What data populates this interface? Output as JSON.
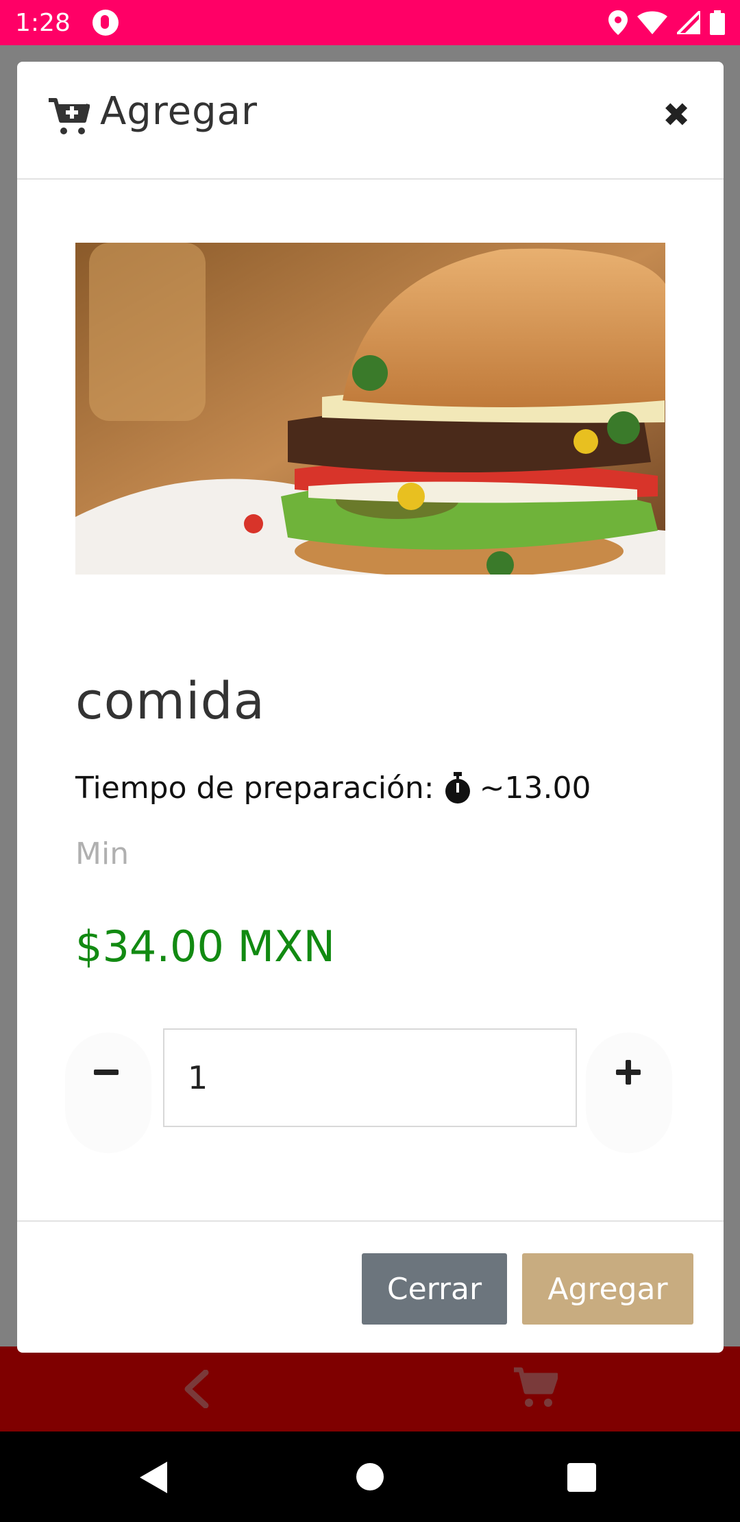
{
  "status_bar": {
    "time": "1:28",
    "icons": [
      "app-notification-icon",
      "location-icon",
      "wifi-icon",
      "signal-icon",
      "battery-icon"
    ]
  },
  "modal": {
    "title": "Agregar",
    "title_icon": "cart-plus-icon",
    "close_icon": "close-icon",
    "product": {
      "image": "burger-photo",
      "name": "comida",
      "prep_label": "Tiempo de preparación:",
      "prep_icon": "stopwatch-icon",
      "prep_value": "~13.00",
      "prep_unit": "Min",
      "price": "$34.00 MXN"
    },
    "quantity": {
      "value": "1",
      "decrement_icon": "minus-icon",
      "increment_icon": "plus-icon"
    },
    "footer": {
      "close_label": "Cerrar",
      "add_label": "Agregar"
    }
  },
  "bottom_nav": {
    "icons": [
      "back-chevron-icon",
      "cart-icon"
    ]
  },
  "colors": {
    "status_bar": "#ff0066",
    "bottom_nav": "#7f0000",
    "price": "#128a12",
    "close_button": "#6c757d",
    "add_button": "#c8ac80"
  }
}
